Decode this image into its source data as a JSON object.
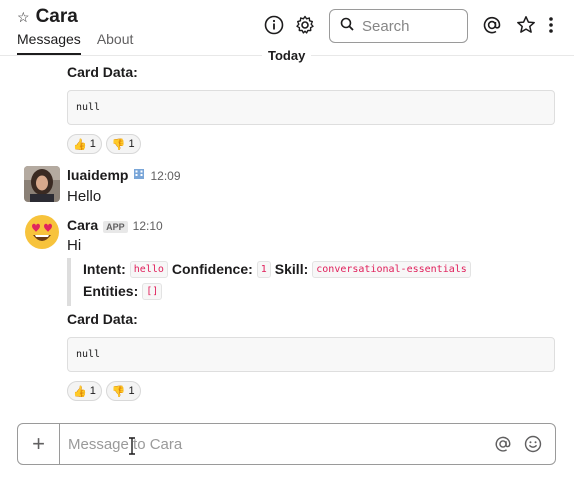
{
  "header": {
    "channel_name": "Cara",
    "tabs": [
      {
        "label": "Messages",
        "active": true
      },
      {
        "label": "About",
        "active": false
      }
    ],
    "search_placeholder": "Search",
    "icons": [
      "star-outline-icon",
      "info-icon",
      "gear-icon",
      "search-icon",
      "at-icon",
      "star-icon",
      "kebab-menu-icon"
    ]
  },
  "divider": {
    "label": "Today"
  },
  "messages": [
    {
      "card_label": "Card Data:",
      "code": "null",
      "reactions": [
        {
          "emoji": "👍",
          "count": "1"
        },
        {
          "emoji": "👎",
          "count": "1"
        }
      ]
    },
    {
      "author": "luaidemp",
      "time": "12:09",
      "text": "Hello",
      "status_icon": "building-icon"
    },
    {
      "author": "Cara",
      "badge": "APP",
      "time": "12:10",
      "text": "Hi",
      "attachment": {
        "intent_label": "Intent:",
        "intent_value": "hello",
        "confidence_label": "Confidence:",
        "confidence_value": "1",
        "skill_label": "Skill:",
        "skill_value": "conversational-essentials",
        "entities_label": "Entities:",
        "entities_value": "[]"
      },
      "card_label": "Card Data:",
      "code": "null",
      "reactions": [
        {
          "emoji": "👍",
          "count": "1"
        },
        {
          "emoji": "👎",
          "count": "1"
        }
      ]
    }
  ],
  "composer": {
    "placeholder": "Message to Cara",
    "plus_label": "+"
  },
  "colors": {
    "accent_code": "#e01e5a",
    "border": "#9a9a9a"
  }
}
